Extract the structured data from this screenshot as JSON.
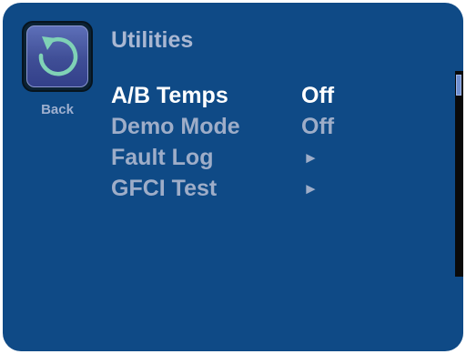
{
  "screen": {
    "title": "Utilities",
    "back_label": "Back",
    "back_icon": "back-arrow-icon"
  },
  "menu": {
    "items": [
      {
        "label": "A/B Temps",
        "value": "Off",
        "selected": true
      },
      {
        "label": "Demo Mode",
        "value": "Off",
        "selected": false
      },
      {
        "label": "Fault Log",
        "value": "►",
        "selected": false
      },
      {
        "label": "GFCI Test",
        "value": "►",
        "selected": false
      }
    ]
  },
  "scrollbar": {
    "position_fraction": 0.0
  },
  "colors": {
    "background": "#0f4a86",
    "selected_text": "#ffffff",
    "dim_text": "#9eadc8",
    "back_arrow": "#7fd2b6"
  }
}
